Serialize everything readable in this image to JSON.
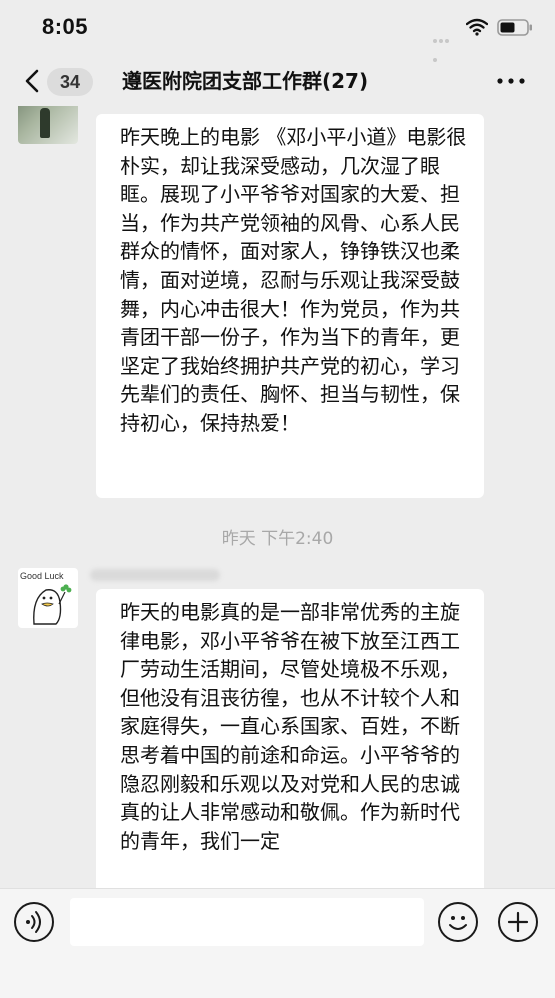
{
  "status_bar": {
    "time": "8:05"
  },
  "nav": {
    "unread_count": "34",
    "title": "遵医附院团支部工作群(27)"
  },
  "messages": [
    {
      "type": "text",
      "text": "昨天晚上的电影 《邓小平小道》电影很朴实，却让我深受感动，几次湿了眼眶。展现了小平爷爷对国家的大爱、担当，作为共产党领袖的风骨、心系人民群众的情怀，面对家人，铮铮铁汉也柔情，面对逆境，忍耐与乐观让我深受鼓舞，内心冲击很大！作为党员，作为共青团干部一份子，作为当下的青年，更坚定了我始终拥护共产党的初心，学习先辈们的责任、胸怀、担当与韧性，保持初心，保持热爱！"
    },
    {
      "type": "timestamp",
      "text": "昨天 下午2:40"
    },
    {
      "type": "text",
      "avatar_caption": "Good Luck",
      "text": "昨天的电影真的是一部非常优秀的主旋律电影，邓小平爷爷在被下放至江西工厂劳动生活期间，尽管处境极不乐观，但他没有沮丧彷徨，也从不计较个人和家庭得失，一直心系国家、百姓，不断思考着中国的前途和命运。小平爷爷的隐忍刚毅和乐观以及对党和人民的忠诚真的让人非常感动和敬佩。作为新时代的青年，我们一定"
    }
  ],
  "input_bar": {
    "placeholder": ""
  },
  "icons": {
    "back": "chevron-left-icon",
    "more": "more-dots-icon",
    "wifi": "wifi-icon",
    "battery": "battery-icon",
    "voice": "voice-icon",
    "emoji": "emoji-icon",
    "add": "plus-icon"
  },
  "colors": {
    "background": "#ededed",
    "bubble": "#ffffff",
    "timestamp": "#a8a8a8",
    "badge": "#dcdcdc"
  }
}
